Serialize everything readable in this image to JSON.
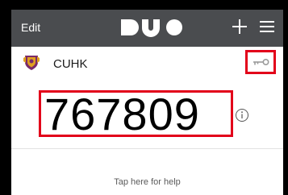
{
  "header": {
    "edit_label": "Edit",
    "logo_text": "DUO",
    "add_icon": "plus-icon",
    "menu_icon": "hamburger-menu-icon"
  },
  "account": {
    "name": "CUHK",
    "logo_icon": "cuhk-crest-icon",
    "key_icon": "key-icon",
    "passcode": "767809",
    "info_icon": "info-icon"
  },
  "help": {
    "label": "Tap here for help"
  },
  "colors": {
    "header_bg": "#4a4c4f",
    "highlight_red": "#e2001a",
    "frame_black": "#000000"
  }
}
